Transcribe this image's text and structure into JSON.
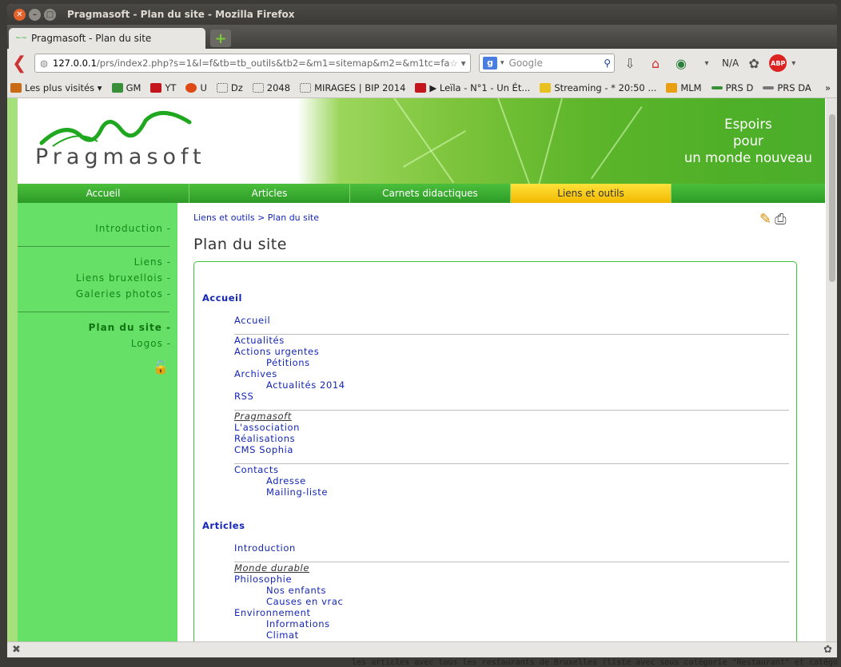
{
  "window": {
    "title": "Pragmasoft - Plan du site - Mozilla Firefox"
  },
  "tab": {
    "label": "Pragmasoft - Plan du site",
    "new_tab": "+"
  },
  "navbar": {
    "url_host": "127.0.0.1",
    "url_path": "/prs/index2.php?s=1&l=f&tb=tb_outils&tb2=&m1=sitemap&m2=&m1tc=fa",
    "search_placeholder": "Google",
    "na_label": "N/A",
    "abp_label": "ABP"
  },
  "bookmarks": [
    {
      "label": "Les plus visités ▾",
      "color": "#c96b14"
    },
    {
      "label": "GM",
      "color": "#3a8f3a"
    },
    {
      "label": "YT",
      "color": "#c4141c"
    },
    {
      "label": "U",
      "color": "#dd4814"
    },
    {
      "label": "Dz",
      "color": "#ffffff"
    },
    {
      "label": "2048",
      "color": "#ffffff"
    },
    {
      "label": "MIRAGES | BIP 2014",
      "color": "#ffffff"
    },
    {
      "label": "▶ Leïla - N°1 - Un Ét...",
      "color": "#c4141c"
    },
    {
      "label": "Streaming - * 20:50 ...",
      "color": "#e8c020"
    },
    {
      "label": "MLM",
      "color": "#e8a010"
    },
    {
      "label": "PRS D",
      "color": "#3a8f3a"
    },
    {
      "label": "PRS DA",
      "color": "#777777"
    }
  ],
  "bookmarks_more": "»",
  "header": {
    "brand": "Pragmasoft",
    "slogan_1": "Espoirs",
    "slogan_2": "pour",
    "slogan_3": "un monde nouveau"
  },
  "menu": [
    {
      "label": "Accueil",
      "active": false
    },
    {
      "label": "Articles",
      "active": false
    },
    {
      "label": "Carnets didactiques",
      "active": false
    },
    {
      "label": "Liens et outils",
      "active": true
    }
  ],
  "sidebar": {
    "introduction": "Introduction -",
    "liens": "Liens -",
    "liens_bruxellois": "Liens bruxellois -",
    "galeries": "Galeries photos -",
    "plan": "Plan du site -",
    "logos": "Logos -"
  },
  "breadcrumb": "Liens et outils > Plan du site",
  "page_title": "Plan du site",
  "sitemap": {
    "accueil_title": "Accueil",
    "accueil": "Accueil",
    "actualites": "Actualités",
    "actions_urgentes": "Actions urgentes",
    "petitions": "Pétitions",
    "archives": "Archives",
    "actualites_2014": "Actualités 2014",
    "rss": "RSS",
    "pragmasoft": "Pragmasoft",
    "association": "L'association",
    "realisations": "Réalisations",
    "cms_sophia": "CMS Sophia",
    "contacts": "Contacts",
    "adresse": "Adresse",
    "mailing": "Mailing-liste",
    "articles_title": "Articles",
    "introduction": "Introduction",
    "monde_durable": "Monde durable",
    "philosophie": "Philosophie",
    "nos_enfants": "Nos enfants",
    "causes_en_vrac": "Causes en vrac",
    "environnement": "Environnement",
    "informations": "Informations",
    "climat": "Climat"
  },
  "background_text": "les articles avec tous les restaurants de Bruxelles (liste avec sous catégorie \"Restaurant\" et catégo"
}
